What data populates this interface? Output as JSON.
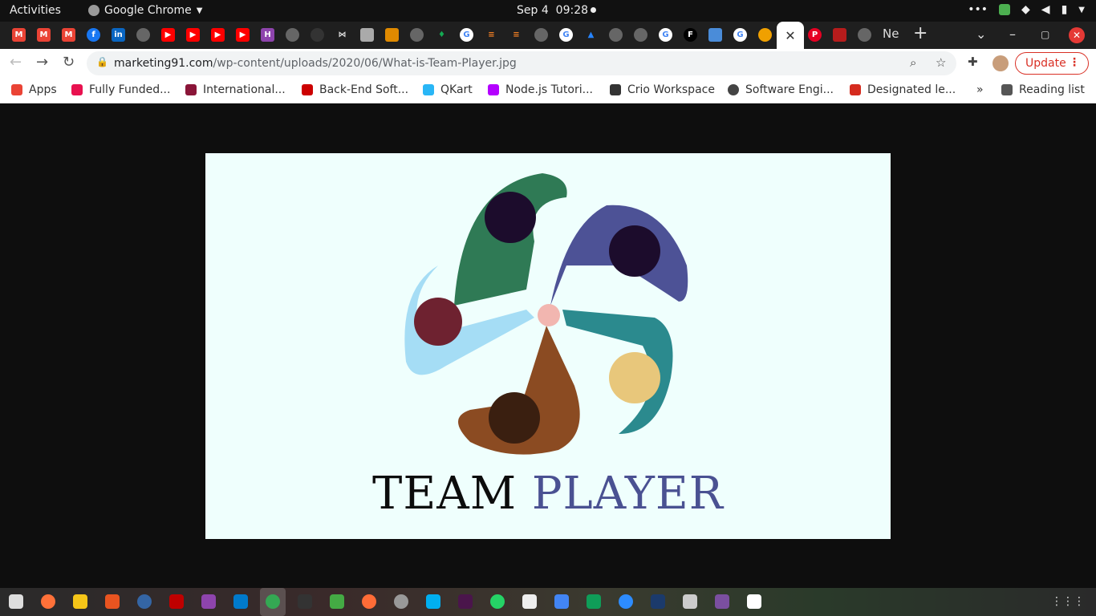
{
  "topbar": {
    "activities": "Activities",
    "app_name": "Google Chrome",
    "date": "Sep 4",
    "time": "09:28"
  },
  "tabs": {
    "last_tab_label": "Ne",
    "new_tab_symbol": "+"
  },
  "toolbar": {
    "url_host": "marketing91.com",
    "url_path": "/wp-content/uploads/2020/06/What-is-Team-Player.jpg",
    "update_label": "Update"
  },
  "bookmarks": [
    {
      "label": "Apps",
      "color": "#ea4335"
    },
    {
      "label": "Fully Funded...",
      "color": "#e8114f"
    },
    {
      "label": "International...",
      "color": "#8a1538"
    },
    {
      "label": "Back-End Soft...",
      "color": "#cc0000"
    },
    {
      "label": "QKart",
      "color": "#29b6f6"
    },
    {
      "label": "Node.js Tutori...",
      "color": "#b400ff"
    },
    {
      "label": "Crio Workspace",
      "color": "#333333"
    },
    {
      "label": "Software Engi...",
      "color": "#444444"
    },
    {
      "label": "Designated le...",
      "color": "#d52b1e"
    },
    {
      "label": "Reading list",
      "color": "#555555"
    }
  ],
  "image": {
    "title_word1": "TEAM",
    "title_word2": "PLAYER",
    "person_colors": [
      "#2f7a55",
      "#4d5296",
      "#a5ddf5",
      "#2b8a8e",
      "#8b4b22"
    ]
  }
}
